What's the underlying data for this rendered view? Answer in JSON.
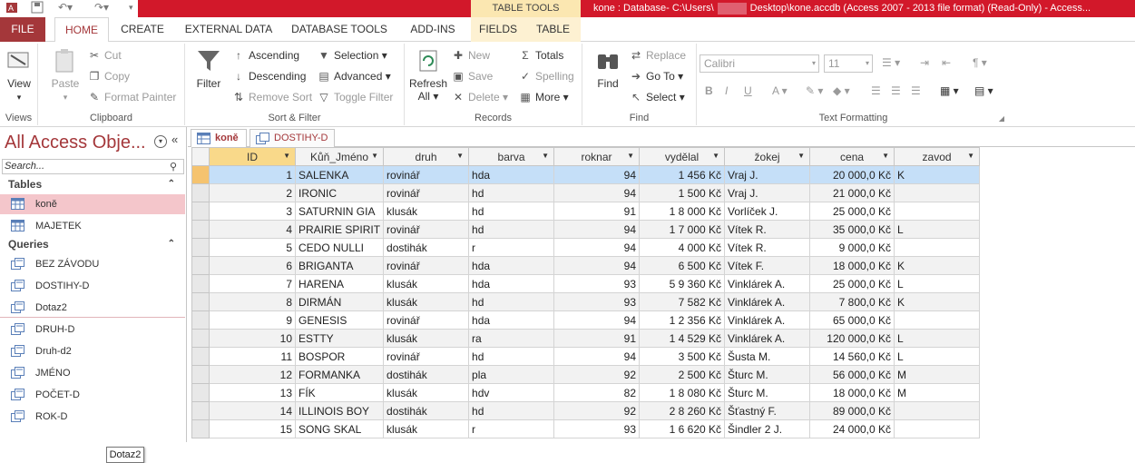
{
  "window": {
    "context_tab": "TABLE TOOLS",
    "title": "kone : Database- C:\\Users\\",
    "title_rest": "Desktop\\kone.accdb (Access 2007 - 2013 file format) (Read-Only) -  Access..."
  },
  "tabs": [
    "FILE",
    "HOME",
    "CREATE",
    "EXTERNAL DATA",
    "DATABASE TOOLS",
    "ADD-INS",
    "FIELDS",
    "TABLE"
  ],
  "ribbon": {
    "views": {
      "view": "View",
      "label": "Views"
    },
    "clipboard": {
      "paste": "Paste",
      "cut": "Cut",
      "copy": "Copy",
      "format_painter": "Format Painter",
      "label": "Clipboard"
    },
    "sort_filter": {
      "filter": "Filter",
      "ascending": "Ascending",
      "descending": "Descending",
      "remove_sort": "Remove Sort",
      "selection": "Selection",
      "advanced": "Advanced",
      "toggle_filter": "Toggle Filter",
      "label": "Sort & Filter"
    },
    "records": {
      "refresh": "Refresh",
      "refresh2": "All",
      "new": "New",
      "save": "Save",
      "delete": "Delete",
      "totals": "Totals",
      "spelling": "Spelling",
      "more": "More",
      "label": "Records"
    },
    "find": {
      "find": "Find",
      "replace": "Replace",
      "goto": "Go To",
      "select": "Select",
      "label": "Find"
    },
    "text": {
      "font": "Calibri",
      "size": "11",
      "label": "Text Formatting",
      "b": "B",
      "i": "I",
      "u": "U"
    }
  },
  "nav": {
    "title": "All Access Obje...",
    "search_placeholder": "Search...",
    "tables_header": "Tables",
    "tables": [
      "koně",
      "MAJETEK"
    ],
    "queries_header": "Queries",
    "queries": [
      "BEZ ZÁVODU",
      "DOSTIHY-D",
      "Dotaz2",
      "DRUH-D",
      "Druh-d2",
      "JMÉNO",
      "POČET-D",
      "ROK-D"
    ],
    "tooltip": "Dotaz2"
  },
  "doc_tabs": [
    "koně",
    "DOSTIHY-D"
  ],
  "grid": {
    "columns": [
      "ID",
      "Kůň_Jméno",
      "druh",
      "barva",
      "roknar",
      "vydělal",
      "žokej",
      "cena",
      "zavod"
    ],
    "rows": [
      [
        "1",
        "SALENKA",
        "rovinář",
        "hda",
        "94",
        "1 456 Kč",
        "Vraj J.",
        "20 000,0 Kč",
        "K"
      ],
      [
        "2",
        "IRONIC",
        "rovinář",
        "hd",
        "94",
        "1 500 Kč",
        "Vraj J.",
        "21 000,0 Kč",
        ""
      ],
      [
        "3",
        "SATURNIN GIA",
        "klusák",
        "hd",
        "91",
        "1 8 000 Kč",
        "Vorlíček J.",
        "25 000,0 Kč",
        ""
      ],
      [
        "4",
        "PRAIRIE SPIRIT",
        "rovinář",
        "hd",
        "94",
        "1 7 000 Kč",
        "Vítek R.",
        "35 000,0 Kč",
        "L"
      ],
      [
        "5",
        "CEDO NULLI",
        "dostihák",
        "r",
        "94",
        "4 000 Kč",
        "Vítek R.",
        "9 000,0 Kč",
        ""
      ],
      [
        "6",
        "BRIGANTA",
        "rovinář",
        "hda",
        "94",
        "6 500 Kč",
        "Vítek F.",
        "18 000,0 Kč",
        "K"
      ],
      [
        "7",
        "HARENA",
        "klusák",
        "hda",
        "93",
        "5 9 360 Kč",
        "Vinklárek A.",
        "25 000,0 Kč",
        "L"
      ],
      [
        "8",
        "DIRMÁN",
        "klusák",
        "hd",
        "93",
        "7 582 Kč",
        "Vinklárek A.",
        "7 800,0 Kč",
        "K"
      ],
      [
        "9",
        "GENESIS",
        "rovinář",
        "hda",
        "94",
        "1 2 356 Kč",
        "Vinklárek A.",
        "65 000,0 Kč",
        ""
      ],
      [
        "10",
        "ESTTY",
        "klusák",
        "ra",
        "91",
        "1 4 529 Kč",
        "Vinklárek A.",
        "120 000,0 Kč",
        "L"
      ],
      [
        "11",
        "BOSPOR",
        "rovinář",
        "hd",
        "94",
        "3 500 Kč",
        "Šusta M.",
        "14 560,0 Kč",
        "L"
      ],
      [
        "12",
        "FORMANKA",
        "dostihák",
        "pla",
        "92",
        "2 500 Kč",
        "Šturc M.",
        "56 000,0 Kč",
        "M"
      ],
      [
        "13",
        "FÍK",
        "klusák",
        "hdv",
        "82",
        "1 8 080 Kč",
        "Šturc M.",
        "18 000,0 Kč",
        "M"
      ],
      [
        "14",
        "ILLINOIS BOY",
        "dostihák",
        "hd",
        "92",
        "2 8 260 Kč",
        "Šťastný F.",
        "89 000,0 Kč",
        ""
      ],
      [
        "15",
        "SONG SKAL",
        "klusák",
        "r",
        "93",
        "1 6 620 Kč",
        "Šindler 2 J.",
        "24 000,0 Kč",
        ""
      ]
    ]
  }
}
